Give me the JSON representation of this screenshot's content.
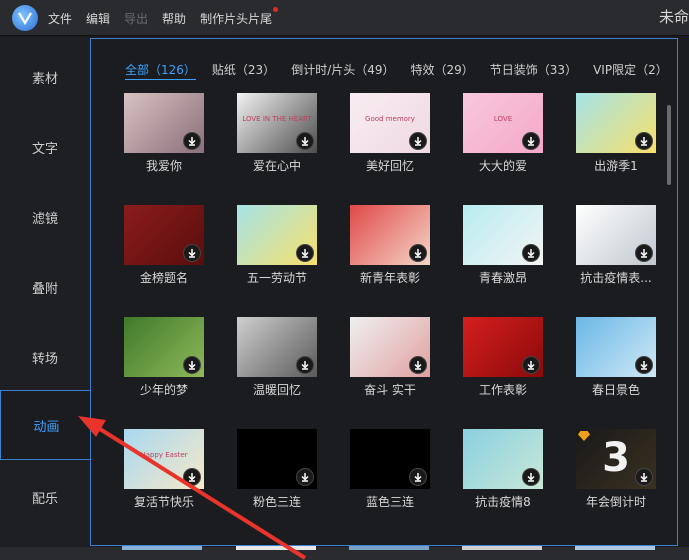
{
  "menu": {
    "items": [
      {
        "label": "文件",
        "disabled": false
      },
      {
        "label": "编辑",
        "disabled": false
      },
      {
        "label": "导出",
        "disabled": true
      },
      {
        "label": "帮助",
        "disabled": false
      },
      {
        "label": "制作片头片尾",
        "disabled": false
      }
    ],
    "title_right": "未命"
  },
  "sidebar": {
    "items": [
      {
        "label": "素材"
      },
      {
        "label": "文字"
      },
      {
        "label": "滤镜"
      },
      {
        "label": "叠附"
      },
      {
        "label": "转场"
      },
      {
        "label": "动画"
      },
      {
        "label": "配乐"
      }
    ],
    "active_index": 5
  },
  "tabs": [
    {
      "label": "全部（126）"
    },
    {
      "label": "贴纸（23）"
    },
    {
      "label": "倒计时/片头（49）"
    },
    {
      "label": "特效（29）"
    },
    {
      "label": "节日装饰（33）"
    },
    {
      "label": "VIP限定（2）"
    }
  ],
  "cards": [
    {
      "label": "我爱你",
      "thumb_text": "",
      "colors": [
        "#d9c2c2",
        "#8a6f7a"
      ]
    },
    {
      "label": "爱在心中",
      "thumb_text": "LOVE IN THE HEART",
      "colors": [
        "#f2f2f2",
        "#4d4d4d"
      ]
    },
    {
      "label": "美好回忆",
      "thumb_text": "Good memory",
      "colors": [
        "#f7eef2",
        "#f0d8e2"
      ]
    },
    {
      "label": "大大的爱",
      "thumb_text": "LOVE",
      "colors": [
        "#f8c8dc",
        "#f4a8c8"
      ]
    },
    {
      "label": "出游季1",
      "thumb_text": "",
      "colors": [
        "#a6e3e8",
        "#f7e06a"
      ]
    },
    {
      "label": "金榜题名",
      "thumb_text": "",
      "colors": [
        "#8b1c1c",
        "#5a0d0d"
      ]
    },
    {
      "label": "五一劳动节",
      "thumb_text": "",
      "colors": [
        "#a6e3e8",
        "#f7e06a"
      ]
    },
    {
      "label": "新青年表彰",
      "thumb_text": "",
      "colors": [
        "#e04848",
        "#f4d7c8"
      ]
    },
    {
      "label": "青春激昂",
      "thumb_text": "",
      "colors": [
        "#b8ecf0",
        "#f4f4f4"
      ]
    },
    {
      "label": "抗击疫情表...",
      "thumb_text": "",
      "colors": [
        "#ffffff",
        "#c0c8d0"
      ]
    },
    {
      "label": "少年的梦",
      "thumb_text": "",
      "colors": [
        "#3f7a2a",
        "#8fb85a"
      ]
    },
    {
      "label": "温暖回忆",
      "thumb_text": "",
      "colors": [
        "#cfcfcf",
        "#5a5a5a"
      ]
    },
    {
      "label": "奋斗 实干",
      "thumb_text": "",
      "colors": [
        "#f0f0f0",
        "#e0a0a0"
      ]
    },
    {
      "label": "工作表彰",
      "thumb_text": "",
      "colors": [
        "#d61e1e",
        "#8a0a0a"
      ]
    },
    {
      "label": "春日景色",
      "thumb_text": "",
      "colors": [
        "#6ab8e8",
        "#cfe8f4"
      ]
    },
    {
      "label": "复活节快乐",
      "thumb_text": "Happy Easter",
      "colors": [
        "#a8d8f0",
        "#f6e8c8"
      ]
    },
    {
      "label": "粉色三连",
      "thumb_text": "",
      "colors": [
        "#000000",
        "#000000"
      ]
    },
    {
      "label": "蓝色三连",
      "thumb_text": "",
      "colors": [
        "#000000",
        "#000000"
      ]
    },
    {
      "label": "抗击疫情8",
      "thumb_text": "",
      "colors": [
        "#8ad0e0",
        "#c8e8d8"
      ]
    },
    {
      "label": "年会倒计时",
      "thumb_text": "3",
      "colors": [
        "#1a1a1a",
        "#3a3020"
      ],
      "vip": true
    }
  ]
}
